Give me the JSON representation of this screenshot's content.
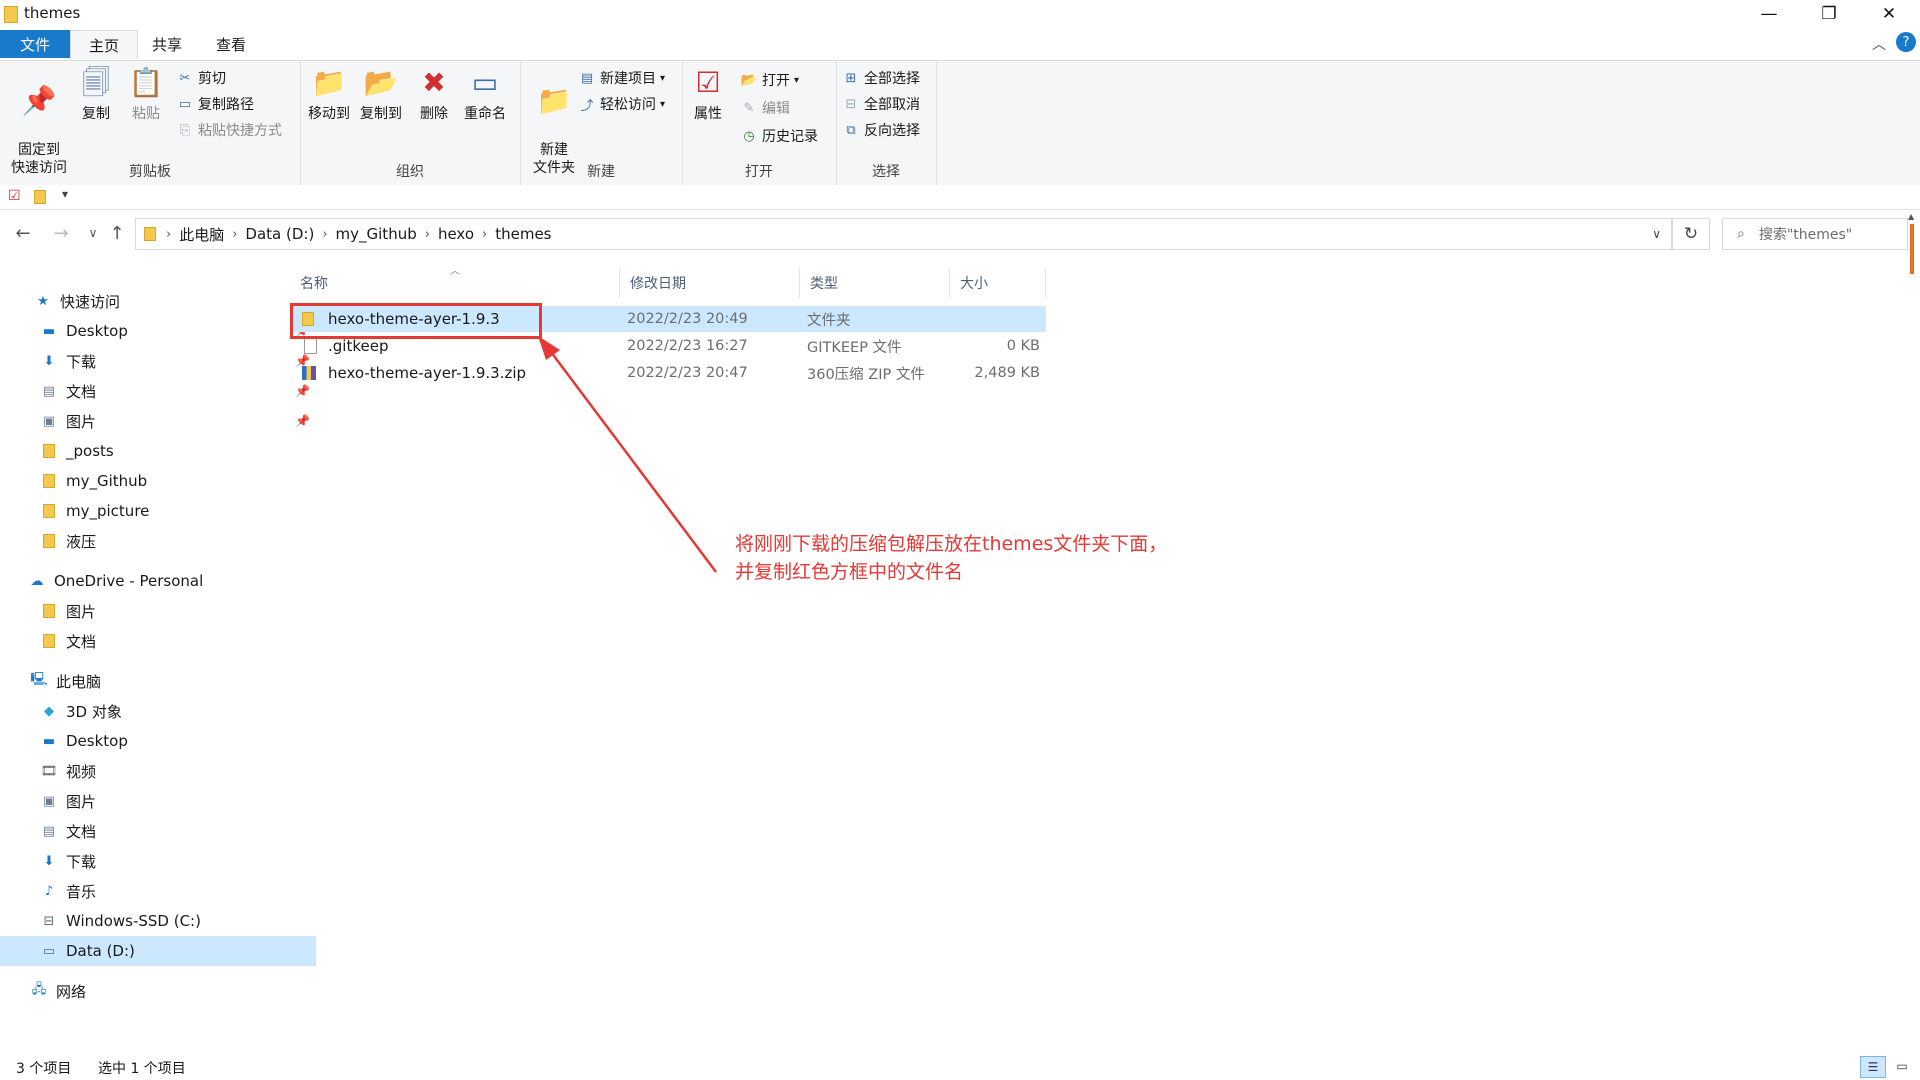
{
  "window": {
    "title": "themes",
    "buttons": {
      "minimize": "—",
      "maximize": "❐",
      "close": "✕"
    }
  },
  "ribbon_tabs": [
    "文件",
    "主页",
    "共享",
    "查看"
  ],
  "ribbon": {
    "clipboard": {
      "label": "剪贴板",
      "pin": "固定到\n快速访问",
      "copy": "复制",
      "paste": "粘贴",
      "cut": "剪切",
      "copy_path": "复制路径",
      "paste_shortcut": "粘贴快捷方式"
    },
    "organize": {
      "label": "组织",
      "move_to": "移动到",
      "copy_to": "复制到",
      "delete": "删除",
      "rename": "重命名"
    },
    "new": {
      "label": "新建",
      "new_folder": "新建\n文件夹",
      "new_item": "新建项目",
      "easy_access": "轻松访问"
    },
    "open": {
      "label": "打开",
      "properties": "属性",
      "open": "打开",
      "edit": "编辑",
      "history": "历史记录"
    },
    "select": {
      "label": "选择",
      "select_all": "全部选择",
      "select_none": "全部取消",
      "invert": "反向选择"
    }
  },
  "address": {
    "crumbs": [
      "此电脑",
      "Data (D:)",
      "my_Github",
      "hexo",
      "themes"
    ],
    "search_placeholder": "搜索\"themes\""
  },
  "nav": {
    "quick_access": "快速访问",
    "quick_items": [
      "Desktop",
      "下载",
      "文档",
      "图片",
      "_posts",
      "my_Github",
      "my_picture",
      "液压"
    ],
    "onedrive": "OneDrive - Personal",
    "onedrive_items": [
      "图片",
      "文档"
    ],
    "this_pc": "此电脑",
    "pc_items": [
      "3D 对象",
      "Desktop",
      "视频",
      "图片",
      "文档",
      "下载",
      "音乐",
      "Windows-SSD (C:)",
      "Data (D:)"
    ],
    "network": "网络"
  },
  "columns": {
    "name": "名称",
    "date": "修改日期",
    "type": "类型",
    "size": "大小"
  },
  "files": [
    {
      "name": "hexo-theme-ayer-1.9.3",
      "date": "2022/2/23 20:49",
      "type": "文件夹",
      "size": ""
    },
    {
      "name": ".gitkeep",
      "date": "2022/2/23 16:27",
      "type": "GITKEEP 文件",
      "size": "0 KB"
    },
    {
      "name": "hexo-theme-ayer-1.9.3.zip",
      "date": "2022/2/23 20:47",
      "type": "360压缩 ZIP 文件",
      "size": "2,489 KB"
    }
  ],
  "status": {
    "count": "3 个项目",
    "selected": "选中 1 个项目"
  },
  "annotation": {
    "line1": "将刚刚下载的压缩包解压放在themes文件夹下面，",
    "line2": "并复制红色方框中的文件名"
  },
  "colors": {
    "accent": "#1979ca",
    "selection": "#cce8ff",
    "annotation": "#e53935"
  }
}
